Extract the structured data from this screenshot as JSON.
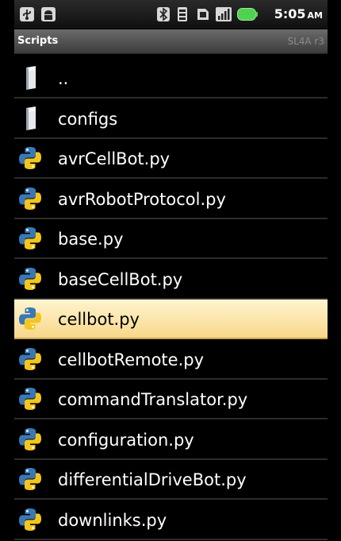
{
  "status_bar": {
    "icons": [
      "usb-icon",
      "android-debug-icon",
      "bluetooth-icon",
      "vibrate-icon",
      "sd-card-icon",
      "signal-icon",
      "battery-icon"
    ],
    "time": "5:05",
    "ampm": "AM"
  },
  "title_bar": {
    "title": "Scripts",
    "version": "SL4A r3"
  },
  "files": [
    {
      "label": "..",
      "icon": "folder-icon",
      "selected": false
    },
    {
      "label": "configs",
      "icon": "folder-icon",
      "selected": false
    },
    {
      "label": "avrCellBot.py",
      "icon": "python-icon",
      "selected": false
    },
    {
      "label": "avrRobotProtocol.py",
      "icon": "python-icon",
      "selected": false
    },
    {
      "label": "base.py",
      "icon": "python-icon",
      "selected": false
    },
    {
      "label": "baseCellBot.py",
      "icon": "python-icon",
      "selected": false
    },
    {
      "label": "cellbot.py",
      "icon": "python-icon",
      "selected": true
    },
    {
      "label": "cellbotRemote.py",
      "icon": "python-icon",
      "selected": false
    },
    {
      "label": "commandTranslator.py",
      "icon": "python-icon",
      "selected": false
    },
    {
      "label": "configuration.py",
      "icon": "python-icon",
      "selected": false
    },
    {
      "label": "differentialDriveBot.py",
      "icon": "python-icon",
      "selected": false
    },
    {
      "label": "downlinks.py",
      "icon": "python-icon",
      "selected": false
    }
  ],
  "colors": {
    "selection_top": "#fff4cf",
    "selection_bottom": "#f7d88a",
    "python_blue": "#3a78b5",
    "python_yellow": "#f3c61f",
    "battery_green": "#4fd24f"
  }
}
